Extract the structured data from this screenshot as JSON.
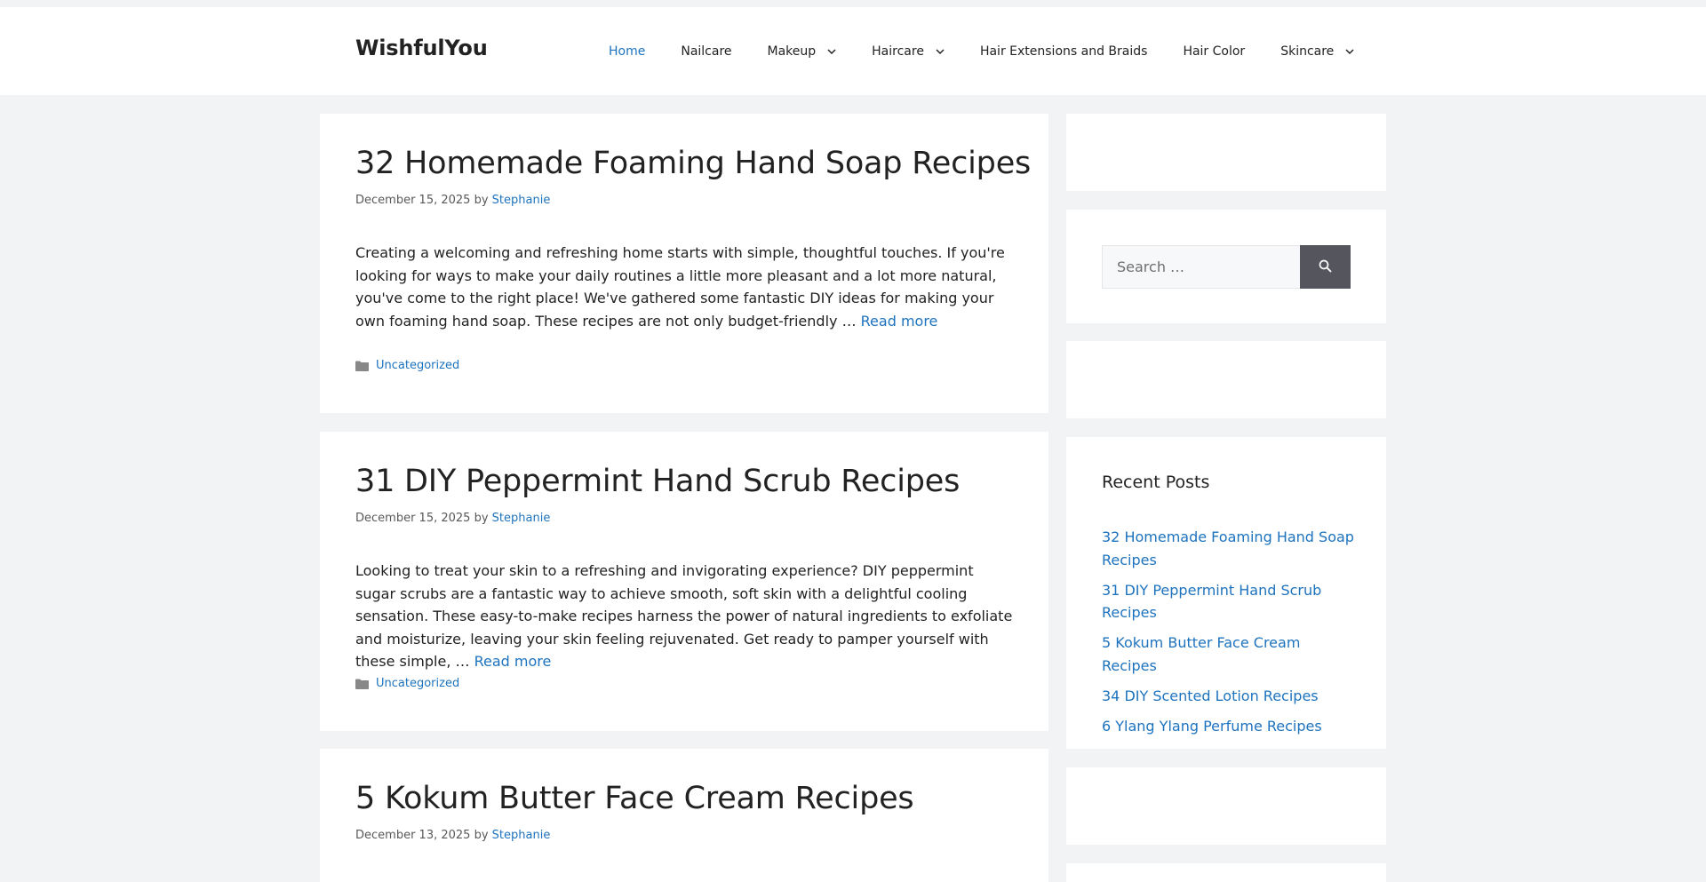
{
  "site": {
    "brand": "WishfulYou"
  },
  "nav": {
    "items": [
      {
        "label": "Home",
        "active": true,
        "dropdown": false
      },
      {
        "label": "Nailcare",
        "active": false,
        "dropdown": false
      },
      {
        "label": "Makeup",
        "active": false,
        "dropdown": true
      },
      {
        "label": "Haircare",
        "active": false,
        "dropdown": true
      },
      {
        "label": "Hair Extensions and Braids",
        "active": false,
        "dropdown": false
      },
      {
        "label": "Hair Color",
        "active": false,
        "dropdown": false
      },
      {
        "label": "Skincare",
        "active": false,
        "dropdown": true
      }
    ]
  },
  "posts": [
    {
      "title": "32 Homemade Foaming Hand Soap Recipes",
      "date": "December 15, 2025",
      "by": "by",
      "author": "Stephanie",
      "excerpt": "Creating a welcoming and refreshing home starts with simple, thoughtful touches. If you're looking for ways to make your daily routines a little more pleasant and a lot more natural, you've come to the right place! We've gathered some fantastic DIY ideas for making your own foaming hand soap. These recipes are not only budget-friendly …",
      "read_more": "Read more",
      "category": "Uncategorized"
    },
    {
      "title": "31 DIY Peppermint Hand Scrub Recipes",
      "date": "December 15, 2025",
      "by": "by",
      "author": "Stephanie",
      "excerpt": "Looking to treat your skin to a refreshing and invigorating experience? DIY peppermint sugar scrubs are a fantastic way to achieve smooth, soft skin with a delightful cooling sensation. These easy-to-make recipes harness the power of natural ingredients to exfoliate and moisturize, leaving your skin feeling rejuvenated. Get ready to pamper yourself with these simple, …",
      "read_more": "Read more",
      "category": "Uncategorized"
    },
    {
      "title": "5 Kokum Butter Face Cream Recipes",
      "date": "December 13, 2025",
      "by": "by",
      "author": "Stephanie"
    }
  ],
  "sidebar": {
    "search": {
      "placeholder": "Search …"
    },
    "recent_posts": {
      "title": "Recent Posts",
      "items": [
        "32 Homemade Foaming Hand Soap Recipes",
        "31 DIY Peppermint Hand Scrub Recipes",
        "5 Kokum Butter Face Cream Recipes",
        "34 DIY Scented Lotion Recipes",
        "6 Ylang Ylang Perfume Recipes"
      ]
    }
  },
  "colors": {
    "accent": "#1e73be",
    "background": "#f2f3f4",
    "search_button": "#55555e"
  }
}
